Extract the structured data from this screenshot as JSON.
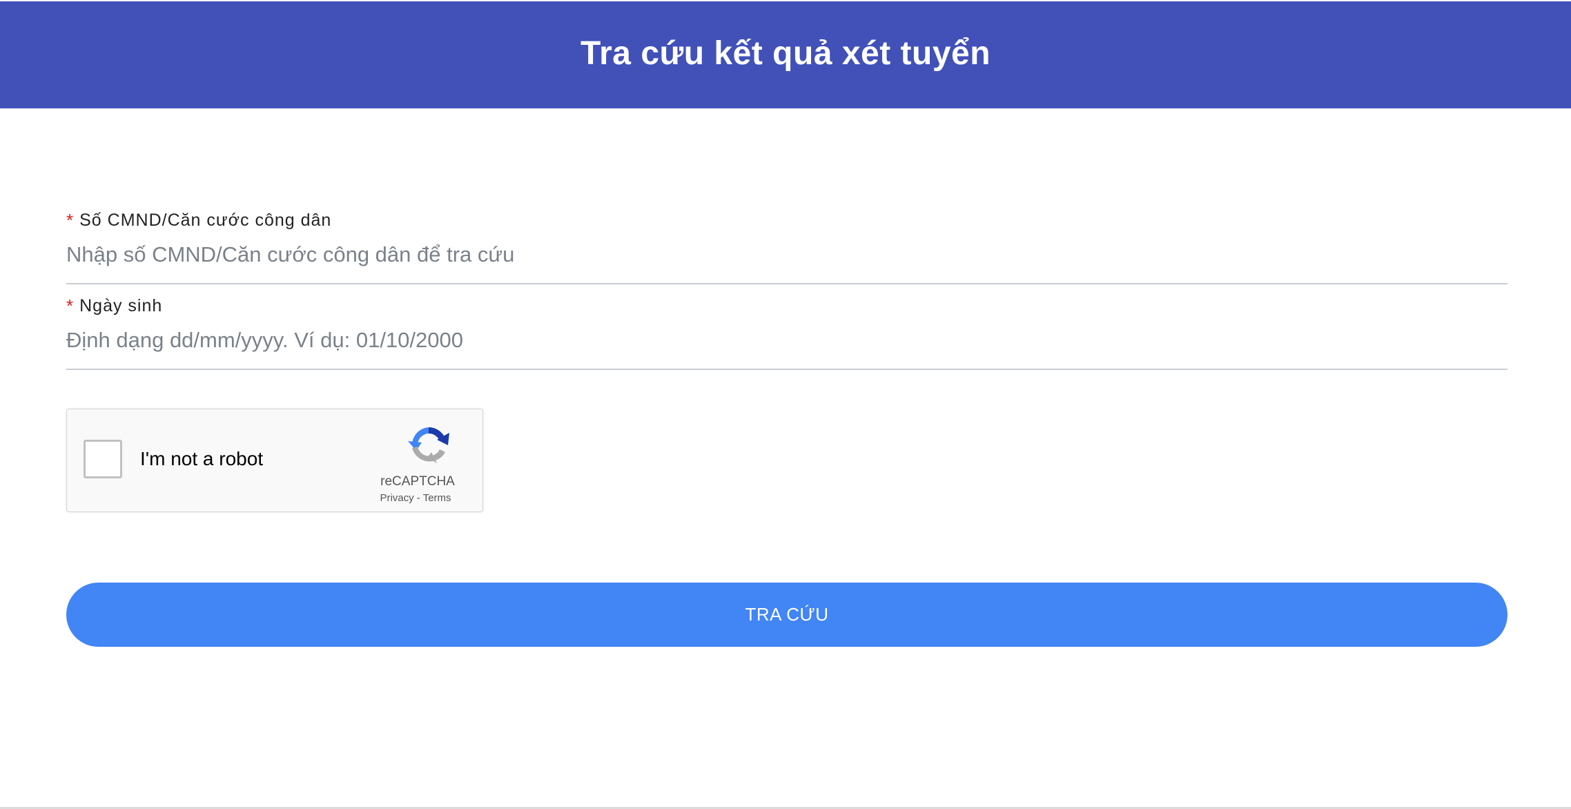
{
  "header": {
    "title": "Tra cứu kết quả xét tuyển",
    "background_color": "#4151b8"
  },
  "form": {
    "id_field": {
      "required_mark": "*",
      "label": "Số CMND/Căn cước công dân",
      "placeholder": "Nhập số CMND/Căn cước công dân để tra cứu",
      "value": ""
    },
    "dob_field": {
      "required_mark": "*",
      "label": "Ngày sinh",
      "placeholder": "Định dạng dd/mm/yyyy. Ví dụ: 01/10/2000",
      "value": ""
    }
  },
  "recaptcha": {
    "checkbox_label": "I'm not a robot",
    "checked": false,
    "brand": "reCAPTCHA",
    "privacy_link": "Privacy",
    "separator": "-",
    "terms_link": "Terms",
    "icon": "recaptcha-logo-icon"
  },
  "submit": {
    "label": "TRA CỨU",
    "color": "#4285f4"
  },
  "colors": {
    "required": "#e02020",
    "input_underline": "#c9cdd2"
  }
}
